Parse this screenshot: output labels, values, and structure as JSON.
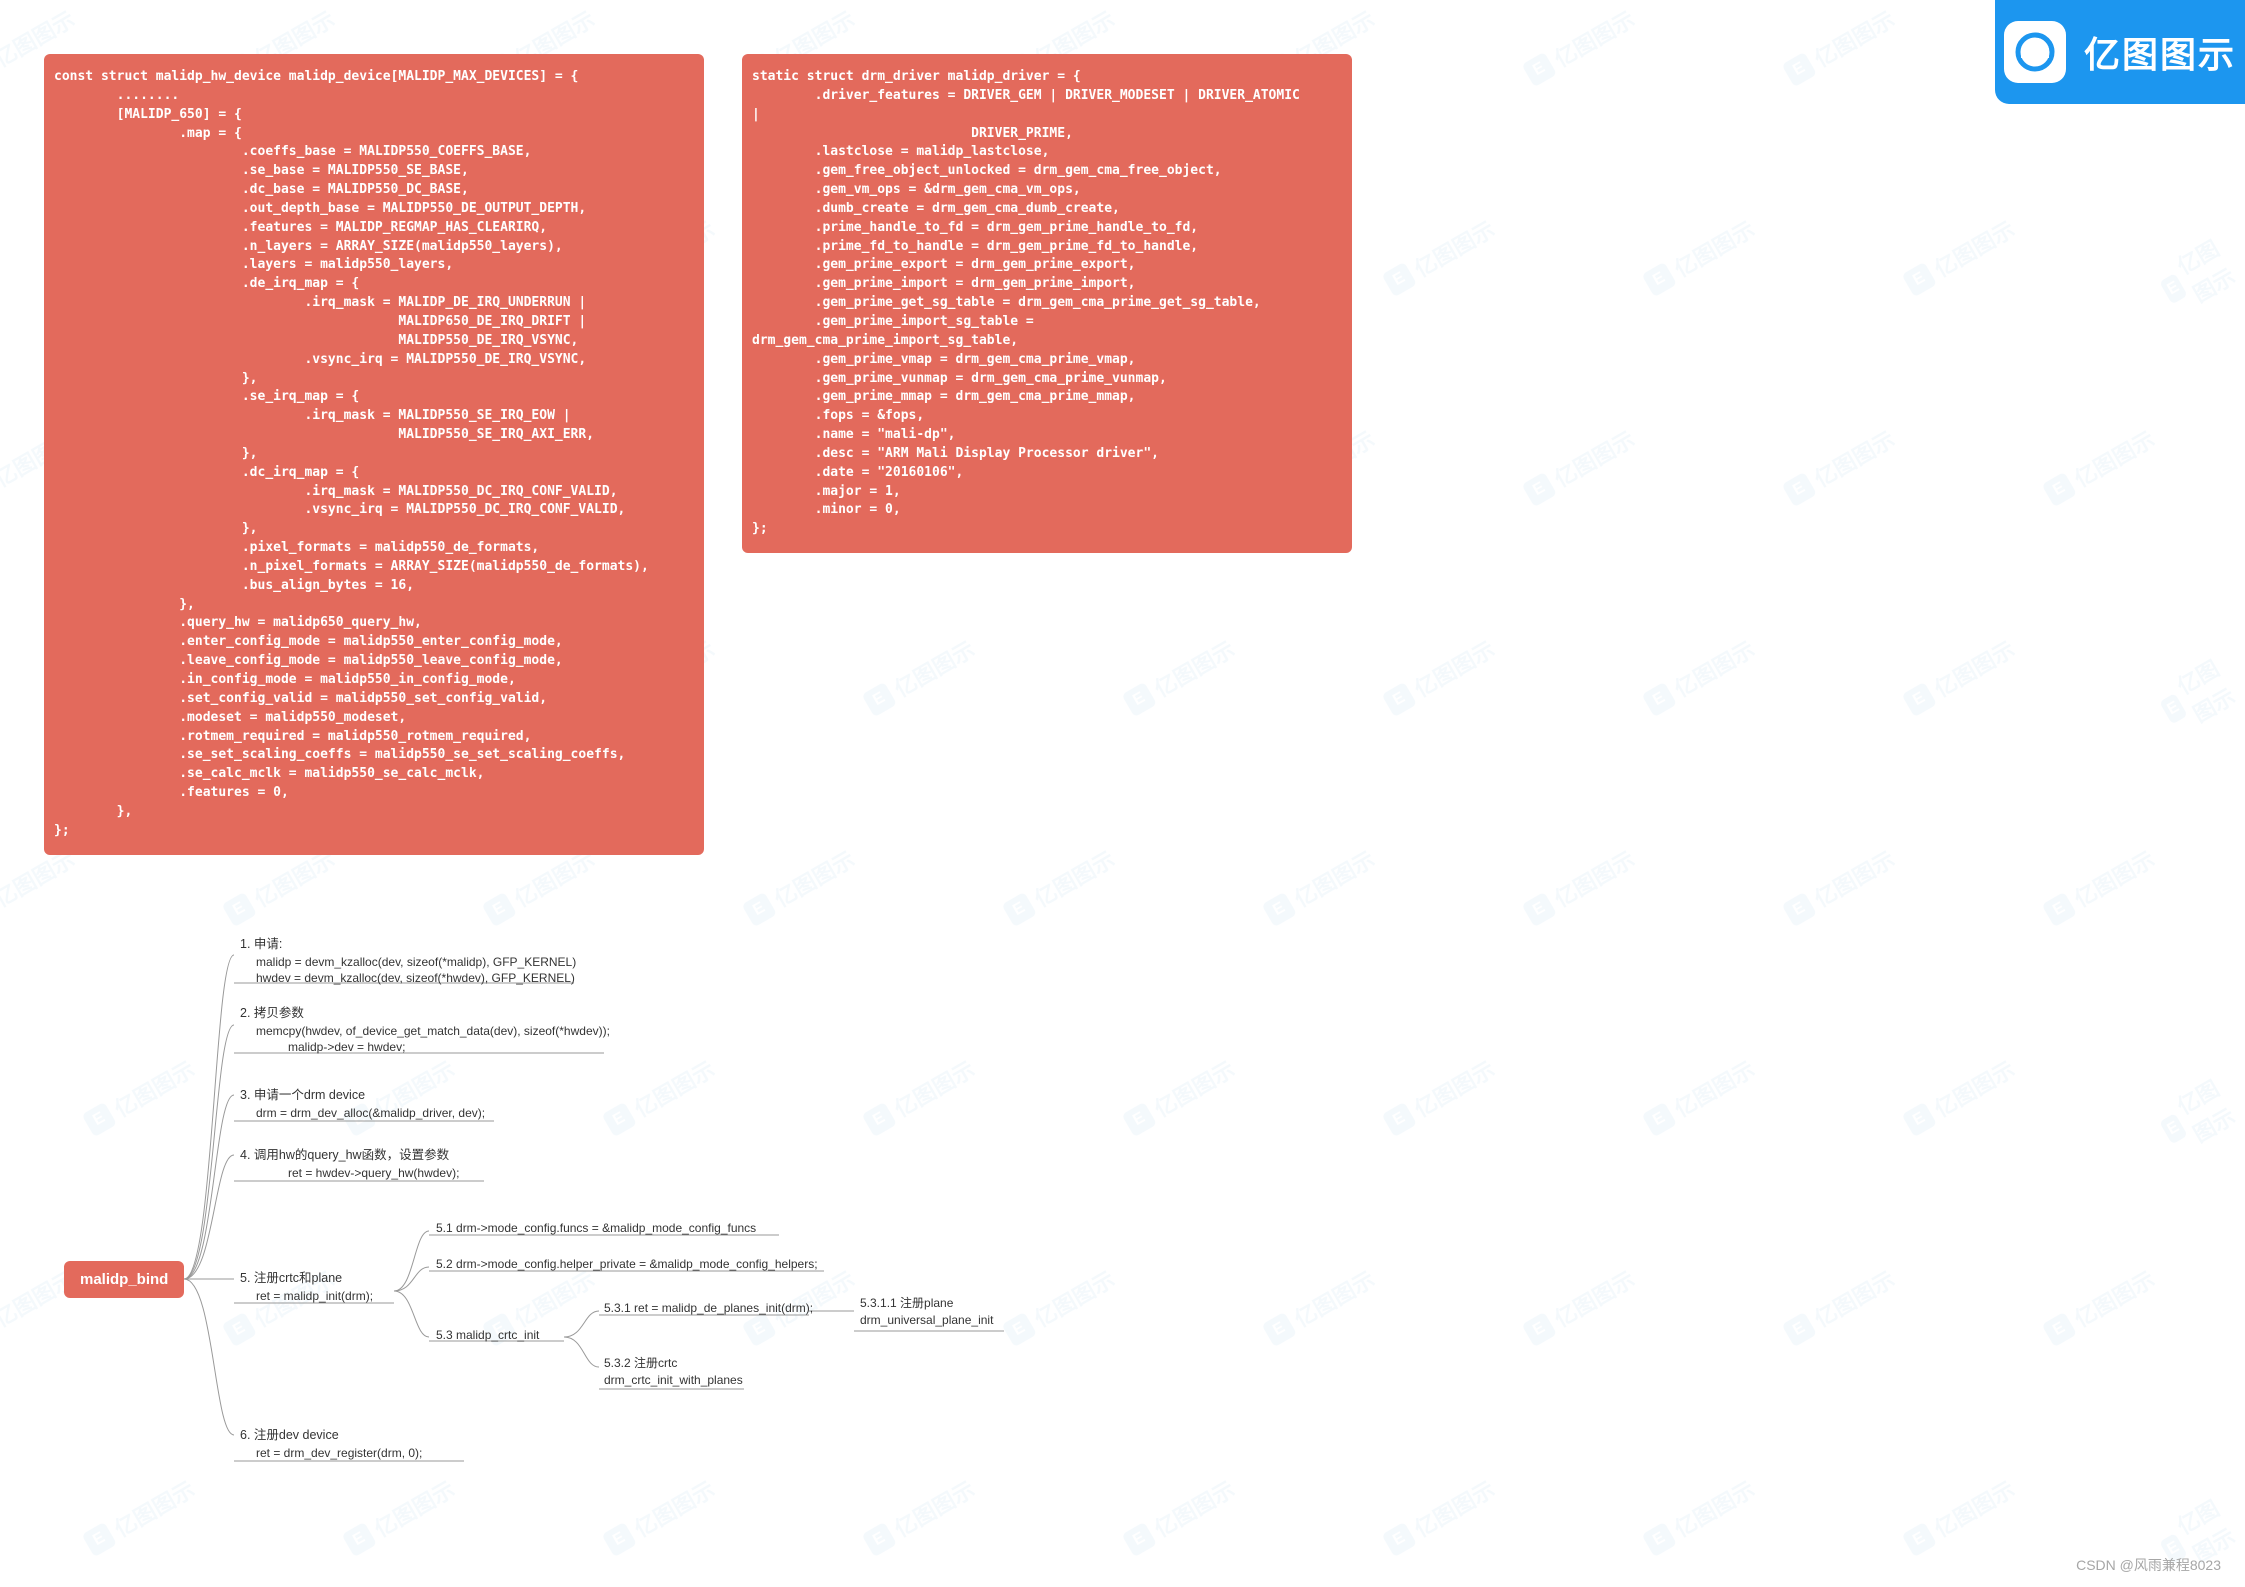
{
  "brand": {
    "name": "亿图图示",
    "logo_letter": "E"
  },
  "watermark_text": "亿图图示",
  "watermark_logo_letter": "E",
  "code_left": "const struct malidp_hw_device malidp_device[MALIDP_MAX_DEVICES] = {\n        ........\n        [MALIDP_650] = {\n                .map = {\n                        .coeffs_base = MALIDP550_COEFFS_BASE,\n                        .se_base = MALIDP550_SE_BASE,\n                        .dc_base = MALIDP550_DC_BASE,\n                        .out_depth_base = MALIDP550_DE_OUTPUT_DEPTH,\n                        .features = MALIDP_REGMAP_HAS_CLEARIRQ,\n                        .n_layers = ARRAY_SIZE(malidp550_layers),\n                        .layers = malidp550_layers,\n                        .de_irq_map = {\n                                .irq_mask = MALIDP_DE_IRQ_UNDERRUN |\n                                            MALIDP650_DE_IRQ_DRIFT |\n                                            MALIDP550_DE_IRQ_VSYNC,\n                                .vsync_irq = MALIDP550_DE_IRQ_VSYNC,\n                        },\n                        .se_irq_map = {\n                                .irq_mask = MALIDP550_SE_IRQ_EOW |\n                                            MALIDP550_SE_IRQ_AXI_ERR,\n                        },\n                        .dc_irq_map = {\n                                .irq_mask = MALIDP550_DC_IRQ_CONF_VALID,\n                                .vsync_irq = MALIDP550_DC_IRQ_CONF_VALID,\n                        },\n                        .pixel_formats = malidp550_de_formats,\n                        .n_pixel_formats = ARRAY_SIZE(malidp550_de_formats),\n                        .bus_align_bytes = 16,\n                },\n                .query_hw = malidp650_query_hw,\n                .enter_config_mode = malidp550_enter_config_mode,\n                .leave_config_mode = malidp550_leave_config_mode,\n                .in_config_mode = malidp550_in_config_mode,\n                .set_config_valid = malidp550_set_config_valid,\n                .modeset = malidp550_modeset,\n                .rotmem_required = malidp550_rotmem_required,\n                .se_set_scaling_coeffs = malidp550_se_set_scaling_coeffs,\n                .se_calc_mclk = malidp550_se_calc_mclk,\n                .features = 0,\n        },\n};",
  "code_right": "static struct drm_driver malidp_driver = {\n        .driver_features = DRIVER_GEM | DRIVER_MODESET | DRIVER_ATOMIC\n|\n                            DRIVER_PRIME,\n        .lastclose = malidp_lastclose,\n        .gem_free_object_unlocked = drm_gem_cma_free_object,\n        .gem_vm_ops = &drm_gem_cma_vm_ops,\n        .dumb_create = drm_gem_cma_dumb_create,\n        .prime_handle_to_fd = drm_gem_prime_handle_to_fd,\n        .prime_fd_to_handle = drm_gem_prime_fd_to_handle,\n        .gem_prime_export = drm_gem_prime_export,\n        .gem_prime_import = drm_gem_prime_import,\n        .gem_prime_get_sg_table = drm_gem_cma_prime_get_sg_table,\n        .gem_prime_import_sg_table =\ndrm_gem_cma_prime_import_sg_table,\n        .gem_prime_vmap = drm_gem_cma_prime_vmap,\n        .gem_prime_vunmap = drm_gem_cma_prime_vunmap,\n        .gem_prime_mmap = drm_gem_cma_prime_mmap,\n        .fops = &fops,\n        .name = \"mali-dp\",\n        .desc = \"ARM Mali Display Processor driver\",\n        .date = \"20160106\",\n        .major = 1,\n        .minor = 0,\n};",
  "mindmap": {
    "root": "malidp_bind",
    "n1": {
      "title": "1. 申请:",
      "l1": "malidp = devm_kzalloc(dev, sizeof(*malidp), GFP_KERNEL)",
      "l2": "hwdev = devm_kzalloc(dev, sizeof(*hwdev), GFP_KERNEL)"
    },
    "n2": {
      "title": "2. 拷贝参数",
      "l1": "memcpy(hwdev, of_device_get_match_data(dev), sizeof(*hwdev));",
      "l2": "malidp->dev = hwdev;"
    },
    "n3": {
      "title": "3. 申请一个drm device",
      "l1": "drm = drm_dev_alloc(&malidp_driver, dev);"
    },
    "n4": {
      "title": "4. 调用hw的query_hw函数，设置参数",
      "l1": "ret = hwdev->query_hw(hwdev);"
    },
    "n5": {
      "title": "5. 注册crtc和plane",
      "l1": "ret = malidp_init(drm);"
    },
    "n51": "5.1 drm->mode_config.funcs = &malidp_mode_config_funcs",
    "n52": "5.2 drm->mode_config.helper_private = &malidp_mode_config_helpers;",
    "n53": "5.3 malidp_crtc_init",
    "n531": {
      "t": "5.3.1 ret = malidp_de_planes_init(drm);"
    },
    "n5311": {
      "t": "5.3.1.1 注册plane",
      "l": "drm_universal_plane_init"
    },
    "n532": {
      "t": "5.3.2 注册crtc",
      "l": "drm_crtc_init_with_planes"
    },
    "n6": {
      "title": "6. 注册dev device",
      "l1": "ret = drm_dev_register(drm, 0);"
    }
  },
  "attribution": "CSDN @风雨兼程8023"
}
